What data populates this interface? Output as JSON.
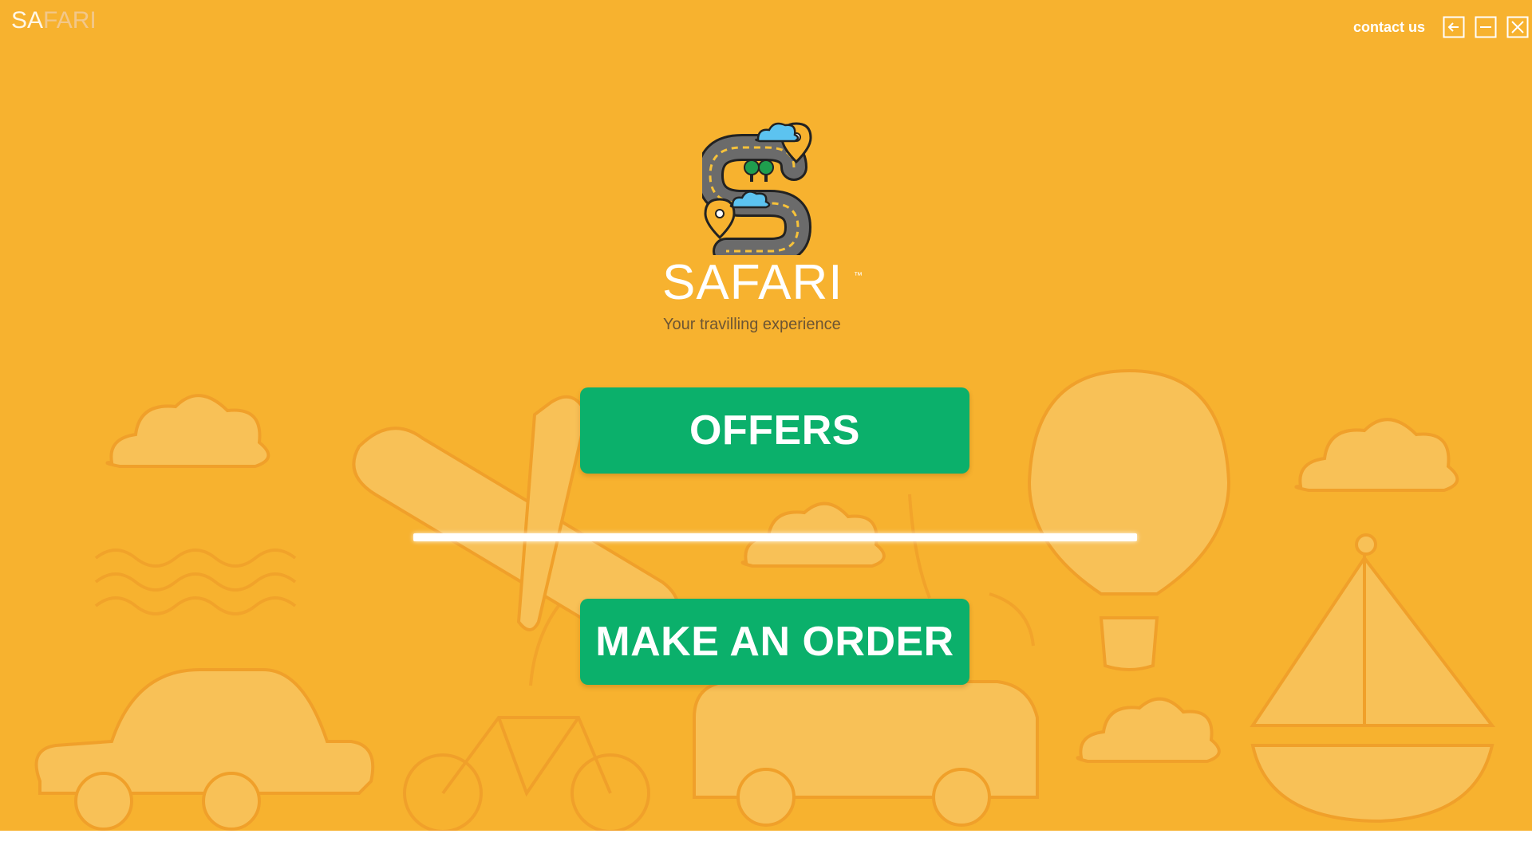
{
  "app": {
    "logo_part1": "SA",
    "logo_part2": "FARI",
    "background_color": "#f7b22f",
    "accent_color": "#0bb06b"
  },
  "header": {
    "contact_label": "contact us",
    "icons": [
      "back-arrow-icon",
      "minimize-icon",
      "close-icon"
    ]
  },
  "brand": {
    "name": "SAFARI",
    "trademark": "™",
    "tagline": "Your travilling experience",
    "mark_icon": "winding-road-s-icon"
  },
  "actions": {
    "offers_label": "OFFERS",
    "order_label": "MAKE AN ORDER"
  }
}
